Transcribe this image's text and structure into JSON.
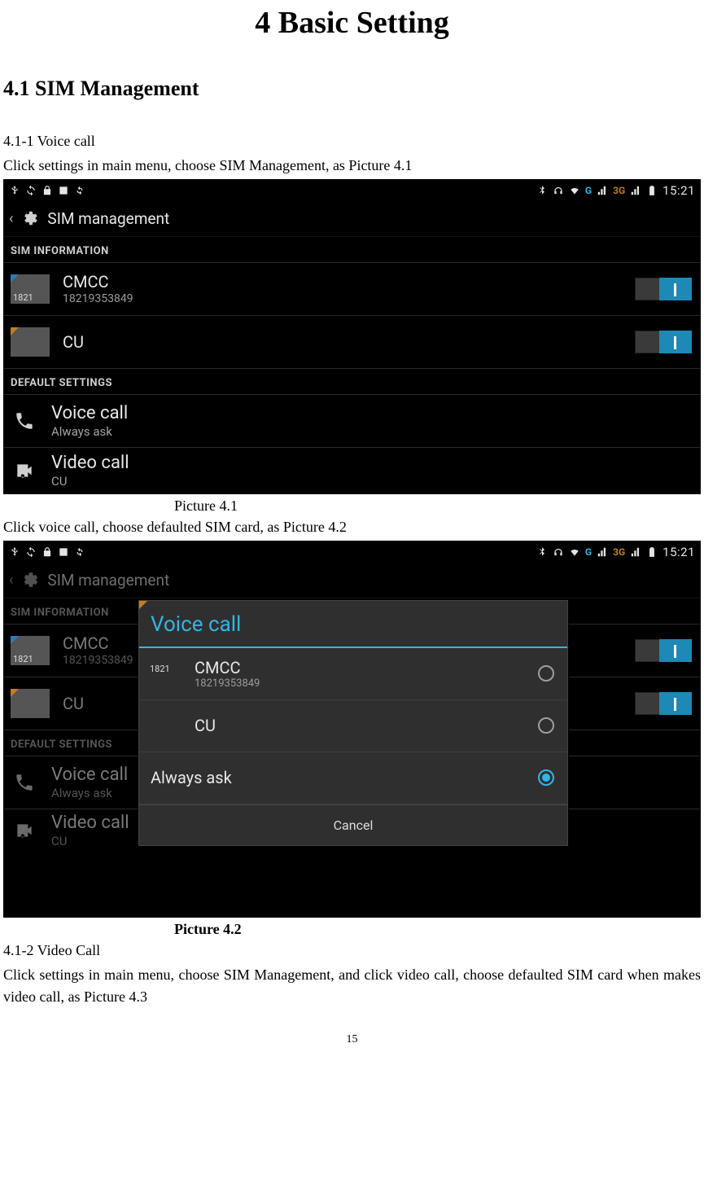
{
  "doc": {
    "title": "4 Basic Setting",
    "section": "4.1 SIM Management",
    "p1": "4.1-1 Voice call",
    "p2": "Click settings in main menu, choose SIM Management, as Picture 4.1",
    "caption1": "Picture 4.1",
    "p3": "Click voice call, choose defaulted SIM card, as Picture 4.2",
    "caption2": "Picture 4.2",
    "p4": "4.1-2 Video Call",
    "p5": "Click settings in main menu, choose SIM Management, and click video call, choose defaulted SIM card when makes video call, as Picture 4.3",
    "pageNum": "15"
  },
  "status": {
    "netG": "G",
    "net3G": "3G",
    "time": "15:21"
  },
  "screen1": {
    "appbar": "SIM management",
    "secInfo": "SIM INFORMATION",
    "sim1": {
      "name": "CMCC",
      "num": "18219353849",
      "chip": "1821"
    },
    "sim2": {
      "name": "CU"
    },
    "secDefault": "DEFAULT SETTINGS",
    "voice": {
      "title": "Voice call",
      "sub": "Always ask"
    },
    "video": {
      "title": "Video call",
      "sub": "CU"
    }
  },
  "screen2": {
    "dialogTitle": "Voice call",
    "opt1": {
      "name": "CMCC",
      "num": "18219353849",
      "chip": "1821"
    },
    "opt2": {
      "name": "CU"
    },
    "opt3": {
      "name": "Always ask"
    },
    "cancel": "Cancel"
  }
}
